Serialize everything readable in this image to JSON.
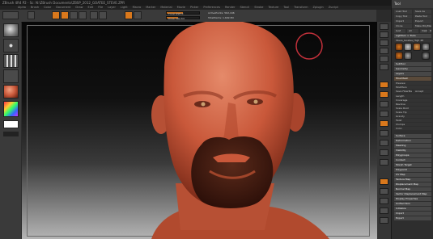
{
  "window": {
    "title": "ZBrush 4R4 P2 - Sc: N:\\ZBrush Documents\\ZBSP_2012_GOATEE_STEVE.ZPR",
    "menus": [
      "Alpha",
      "Brush",
      "Color",
      "Document",
      "Draw",
      "Edit",
      "File",
      "Layer",
      "Light",
      "Macro",
      "Marker",
      "Material",
      "Movie",
      "Picker",
      "Preferences",
      "Render",
      "Stencil",
      "Stroke",
      "Texture",
      "Tool",
      "Transform",
      "Zplugin",
      "Zscript"
    ]
  },
  "toolbar": {
    "sliders": [
      {
        "label": "Focal Shift",
        "value": "0",
        "fraction": 0.5
      },
      {
        "label": "Draw Size",
        "value": "64",
        "fraction": 0.35
      },
      {
        "label": "ActivePoints: 562,446",
        "value": "",
        "fraction": 0.0
      },
      {
        "label": "TotalPoints: 1,699 Mil",
        "value": "",
        "fraction": 0.0
      }
    ]
  },
  "tray": {
    "title": "Tool",
    "items": [
      "Load Tool",
      "Save As",
      "Copy Tool",
      "Paste Tool",
      "Import",
      "Export",
      "Clone",
      "Make PolyMesh3D",
      "GoZ",
      "All",
      "Visible",
      "R",
      "Lightbox > Tools",
      "Steve_Goatee_High 48",
      "SubTool",
      "Geometry",
      "Layers",
      "FiberMesh",
      "Preview",
      "Modifiers",
      "Save FiberMesh",
      "Accept",
      "Length",
      "Coverage",
      "Revolve",
      "Scale Root",
      "Scale Tip",
      "Gravity",
      "Twist",
      "Clumps",
      "Color",
      "Surface",
      "Deformation",
      "Masking",
      "Visibility",
      "Polygroups",
      "Contact",
      "Morph Target",
      "Polypaint",
      "UV Map",
      "Texture Map",
      "Displacement Map",
      "Normal Map",
      "Vector Displacement Map",
      "Display Properties",
      "Unified Skin",
      "Initialize",
      "Import",
      "Export"
    ]
  },
  "colors": {
    "accent": "#d9781c",
    "background": "#2b2b2b",
    "skin": "#c9583a",
    "beard": "#3a1a12"
  }
}
